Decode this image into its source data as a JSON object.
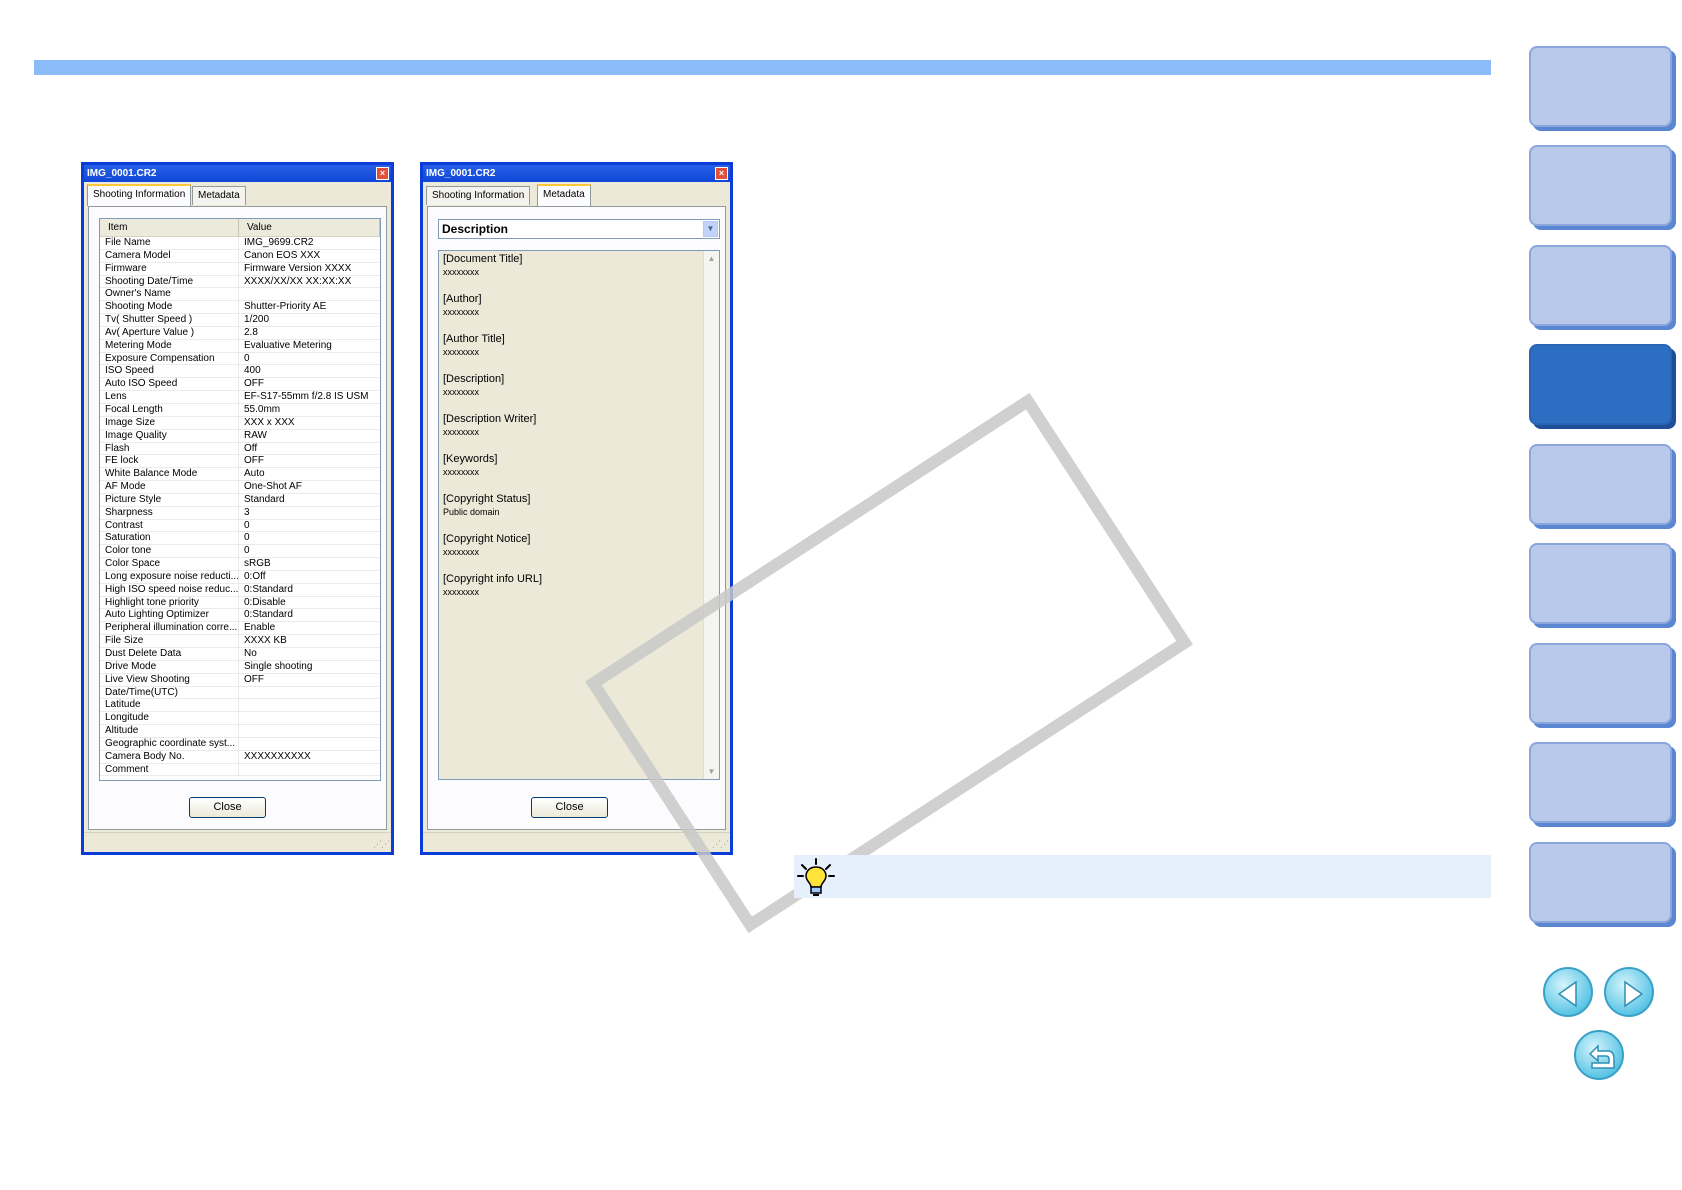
{
  "left_dialog": {
    "title": "IMG_0001.CR2",
    "close_x": "×",
    "tabs": [
      {
        "label": "Shooting Information"
      },
      {
        "label": "Metadata"
      }
    ],
    "table": {
      "headers": [
        "Item",
        "Value"
      ],
      "rows": [
        [
          "File Name",
          "IMG_9699.CR2"
        ],
        [
          "Camera Model",
          "Canon EOS XXX"
        ],
        [
          "Firmware",
          "Firmware Version XXXX"
        ],
        [
          "Shooting Date/Time",
          "XXXX/XX/XX XX:XX:XX"
        ],
        [
          "Owner's Name",
          ""
        ],
        [
          "Shooting Mode",
          "Shutter-Priority AE"
        ],
        [
          "Tv( Shutter Speed )",
          "1/200"
        ],
        [
          "Av( Aperture Value )",
          "2.8"
        ],
        [
          "Metering Mode",
          "Evaluative Metering"
        ],
        [
          "Exposure Compensation",
          "0"
        ],
        [
          "ISO Speed",
          "400"
        ],
        [
          "Auto ISO Speed",
          "OFF"
        ],
        [
          "Lens",
          "EF-S17-55mm f/2.8 IS USM"
        ],
        [
          "Focal Length",
          "55.0mm"
        ],
        [
          "Image Size",
          "XXX x XXX"
        ],
        [
          "Image Quality",
          "RAW"
        ],
        [
          "Flash",
          "Off"
        ],
        [
          "FE lock",
          "OFF"
        ],
        [
          "White Balance Mode",
          "Auto"
        ],
        [
          "AF Mode",
          "One-Shot AF"
        ],
        [
          "Picture Style",
          "Standard"
        ],
        [
          "Sharpness",
          "3"
        ],
        [
          "Contrast",
          "0"
        ],
        [
          "Saturation",
          "0"
        ],
        [
          "Color tone",
          "0"
        ],
        [
          "Color Space",
          "sRGB"
        ],
        [
          "Long exposure noise reducti...",
          "0:Off"
        ],
        [
          "High ISO speed noise reduc...",
          "0:Standard"
        ],
        [
          "Highlight tone priority",
          "0:Disable"
        ],
        [
          "Auto Lighting Optimizer",
          "0:Standard"
        ],
        [
          "Peripheral illumination corre...",
          "Enable"
        ],
        [
          "File Size",
          "XXXX KB"
        ],
        [
          "Dust Delete Data",
          "No"
        ],
        [
          "Drive Mode",
          "Single shooting"
        ],
        [
          "Live View Shooting",
          "OFF"
        ],
        [
          "Date/Time(UTC)",
          ""
        ],
        [
          "Latitude",
          ""
        ],
        [
          "Longitude",
          ""
        ],
        [
          "Altitude",
          ""
        ],
        [
          "Geographic coordinate syst...",
          ""
        ],
        [
          "Camera Body No.",
          "XXXXXXXXXX"
        ],
        [
          "Comment",
          ""
        ]
      ]
    },
    "close_label": "Close"
  },
  "right_dialog": {
    "title": "IMG_0001.CR2",
    "close_x": "×",
    "tabs": [
      {
        "label": "Shooting Information"
      },
      {
        "label": "Metadata"
      }
    ],
    "dropdown_value": "Description",
    "fields": [
      {
        "label": "[Document Title]",
        "value": "xxxxxxxx"
      },
      {
        "label": "[Author]",
        "value": "xxxxxxxx"
      },
      {
        "label": "[Author Title]",
        "value": "xxxxxxxx"
      },
      {
        "label": "[Description]",
        "value": "xxxxxxxx"
      },
      {
        "label": "[Description Writer]",
        "value": "xxxxxxxx"
      },
      {
        "label": "[Keywords]",
        "value": "xxxxxxxx"
      },
      {
        "label": "[Copyright Status]",
        "value": "Public domain"
      },
      {
        "label": "[Copyright Notice]",
        "value": "xxxxxxxx"
      },
      {
        "label": "[Copyright info URL]",
        "value": "xxxxxxxx"
      }
    ],
    "close_label": "Close"
  },
  "colors": {
    "top_bar": "#8bbcf9",
    "side_tab": "#b9c9ea",
    "side_tab_active": "#2d6ec3",
    "hint_bar": "#e6f0fc"
  },
  "side_nav": {
    "tab_count": 9,
    "active_index": 3
  },
  "icons": {
    "hint": "lightbulb-icon",
    "prev": "arrow-left-icon",
    "next": "arrow-right-icon",
    "back": "return-icon"
  }
}
